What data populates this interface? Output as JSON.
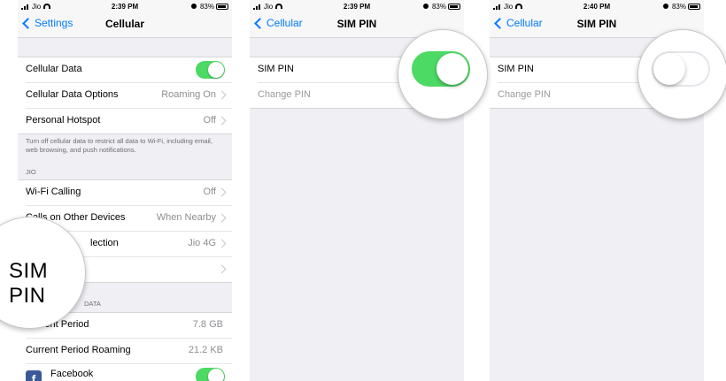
{
  "status_left": "Jio",
  "screens": [
    {
      "time": "2:39 PM",
      "battery": "83%",
      "back_label": "Settings",
      "title": "Cellular",
      "rows_group1": [
        {
          "label": "Cellular Data",
          "toggle_on": true
        },
        {
          "label": "Cellular Data Options",
          "value": "Roaming On"
        },
        {
          "label": "Personal Hotspot",
          "value": "Off"
        }
      ],
      "footer_text": "Turn off cellular data to restrict all data to Wi-Fi, including email, web browsing, and push notifications.",
      "section_jio": "JIO",
      "rows_group2": [
        {
          "label": "Wi-Fi Calling",
          "value": "Off"
        },
        {
          "label": "Calls on Other Devices",
          "value": "When Nearby"
        },
        {
          "label": "lection",
          "value": "Jio 4G"
        }
      ],
      "magnifier_text": "SIM PIN",
      "section_data": "DATA",
      "rows_group3": [
        {
          "label": "Current Period",
          "value": "7.8 GB"
        },
        {
          "label": "Current Period Roaming",
          "value": "21.2 KB"
        },
        {
          "label": "Facebook",
          "toggle_on": true
        }
      ]
    },
    {
      "time": "2:39 PM",
      "battery": "83%",
      "back_label": "Cellular",
      "title": "SIM PIN",
      "sim_pin_label": "SIM PIN",
      "change_pin_label": "Change PIN",
      "sim_pin_on": true
    },
    {
      "time": "2:40 PM",
      "battery": "83%",
      "back_label": "Cellular",
      "title": "SIM PIN",
      "sim_pin_label": "SIM PIN",
      "change_pin_label": "Change PIN",
      "sim_pin_on": false
    }
  ]
}
